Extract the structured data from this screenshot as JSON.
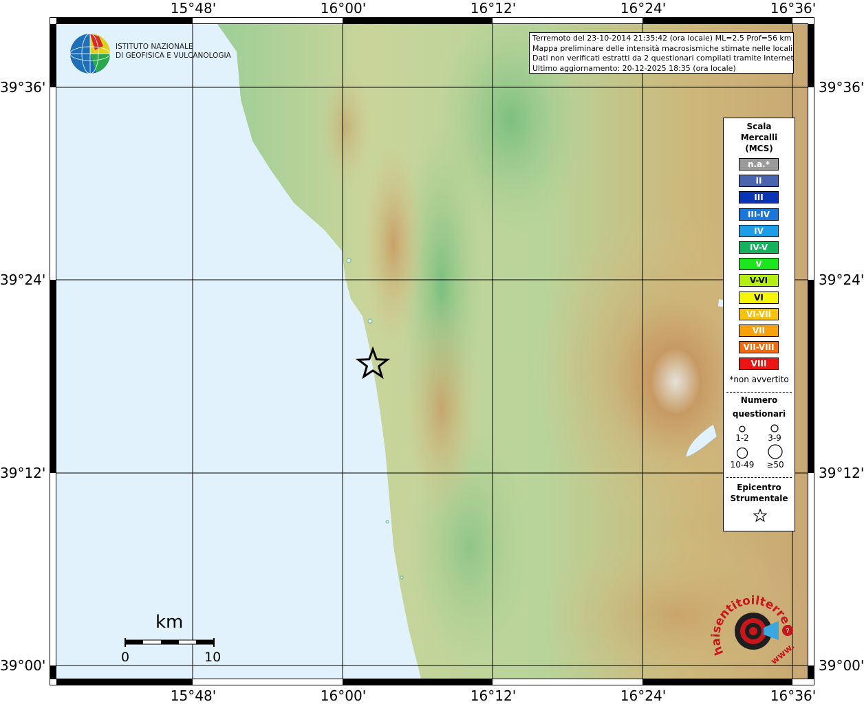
{
  "coordinates": {
    "top_longitudes": [
      "15°48'",
      "16°00'",
      "16°12'",
      "16°24'",
      "16°36'"
    ],
    "bottom_longitudes": [
      "15°48'",
      "16°00'",
      "16°12'",
      "16°24'",
      "16°36'"
    ],
    "left_latitudes": [
      "39°36'",
      "39°24'",
      "39°12'",
      "39°00'"
    ],
    "right_latitudes": [
      "39°36'",
      "39°24'",
      "39°12'",
      "39°00'"
    ]
  },
  "institute": {
    "name_line1": "ISTITUTO NAZIONALE",
    "name_line2": "DI GEOFISICA E VULCANOLOGIA"
  },
  "info": {
    "line1": "Terremoto del 23-10-2014 21:35:42 (ora locale) ML=2.5 Prof=56 km",
    "line2": "Mappa preliminare delle intensità macrosismiche stimate nelle località",
    "line3": "Dati non verificati estratti da 2 questionari compilati tramite Internet.",
    "line4": "Ultimo aggiornamento: 20-12-2025 18:35 (ora locale)"
  },
  "legend": {
    "title1": "Scala",
    "title2": "Mercalli",
    "title3": "(MCS)",
    "classes": [
      {
        "label": "n.a.*",
        "color": "#9a9a9a"
      },
      {
        "label": "II",
        "color": "#4a64ad"
      },
      {
        "label": "III",
        "color": "#0b33b5"
      },
      {
        "label": "III-IV",
        "color": "#1a77d9"
      },
      {
        "label": "IV",
        "color": "#1e9ee6"
      },
      {
        "label": "IV-V",
        "color": "#14b25a"
      },
      {
        "label": "V",
        "color": "#1ee61e"
      },
      {
        "label": "V-VI",
        "color": "#b4ef14"
      },
      {
        "label": "VI",
        "color": "#f5f50a"
      },
      {
        "label": "VI-VII",
        "color": "#f7c20a"
      },
      {
        "label": "VII",
        "color": "#f7a00a"
      },
      {
        "label": "VII-VIII",
        "color": "#f56a0a"
      },
      {
        "label": "VIII",
        "color": "#ee1414"
      }
    ],
    "not_felt_note": "*non avvertito",
    "count_title1": "Numero",
    "count_title2": "questionari",
    "count_labels": [
      "1-2",
      "3-9",
      "10-49",
      "≥50"
    ],
    "epicenter_title1": "Epicentro",
    "epicenter_title2": "Strumentale"
  },
  "scale_bar": {
    "unit": "km",
    "start": "0",
    "end": "10"
  },
  "epicenter": {
    "lon": 16.04,
    "lat": 39.31
  },
  "haisentito_logo": {
    "text": "haisentitoilterremoto.it",
    "sub": "www."
  },
  "colors": {
    "sea": "#e2f2fc",
    "lowland": "#7fbf82",
    "hills": "#d8d39a",
    "mountains": "#c59b62"
  }
}
